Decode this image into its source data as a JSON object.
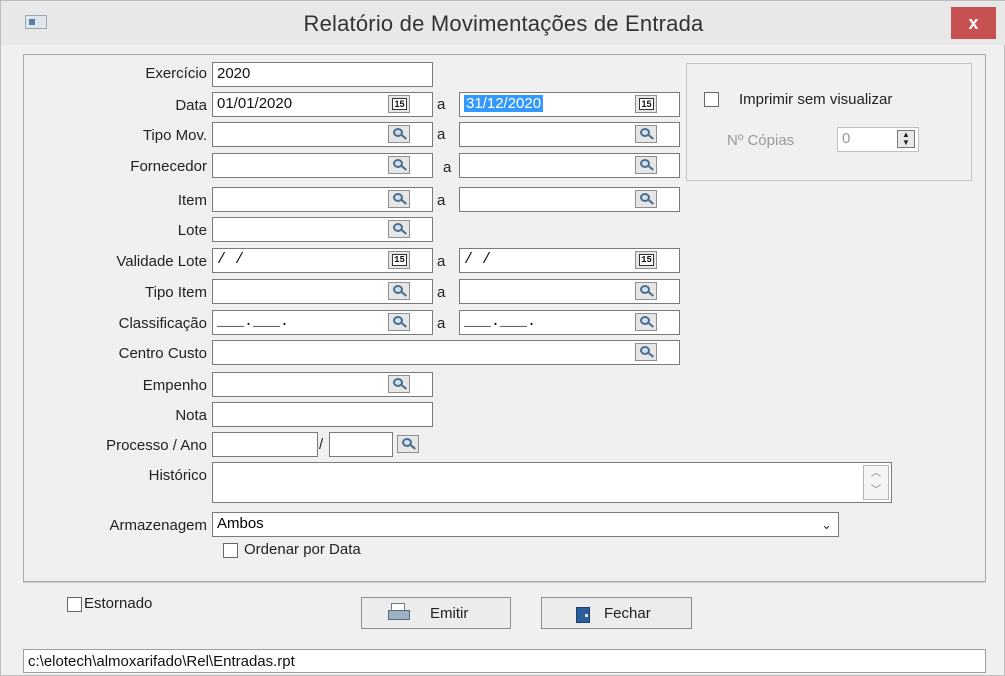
{
  "window": {
    "title": "Relatório de Movimentações de Entrada",
    "close_label": "x"
  },
  "form": {
    "exercicio": {
      "label": "Exercício",
      "value": "2020"
    },
    "data": {
      "label": "Data",
      "from": "01/01/2020",
      "to": "31/12/2020"
    },
    "tipo_mov": {
      "label": "Tipo Mov."
    },
    "fornecedor": {
      "label": "Fornecedor"
    },
    "item": {
      "label": "Item"
    },
    "lote": {
      "label": "Lote"
    },
    "validade_lote": {
      "label": "Validade Lote",
      "from": " /  /",
      "to": " /  /"
    },
    "tipo_item": {
      "label": "Tipo Item"
    },
    "classificacao": {
      "label": "Classificação",
      "from": "___.___.",
      "to": "___.___."
    },
    "centro_custo": {
      "label": "Centro Custo"
    },
    "empenho": {
      "label": "Empenho"
    },
    "nota": {
      "label": "Nota"
    },
    "processo": {
      "label": "Processo / Ano",
      "sep": "/"
    },
    "historico": {
      "label": "Histórico"
    },
    "armazenagem": {
      "label": "Armazenagem",
      "value": "Ambos"
    },
    "range_sep": "a",
    "ordenar_label": "Ordenar por Data"
  },
  "print_options": {
    "imprimir_sem_visualizar": "Imprimir sem visualizar",
    "copias_label": "Nº Cópias",
    "copias_value": "0"
  },
  "footer": {
    "estornado_label": "Estornado",
    "emitir_label": "Emitir",
    "fechar_label": "Fechar",
    "status_path": "c:\\elotech\\almoxarifado\\Rel\\Entradas.rpt"
  },
  "icons": {
    "calendar_text": "15",
    "search": "magnifier-icon",
    "calendar": "calendar-icon",
    "printer": "printer-icon",
    "door": "door-icon"
  },
  "colors": {
    "close": "#c75050",
    "selection": "#3399ff"
  }
}
